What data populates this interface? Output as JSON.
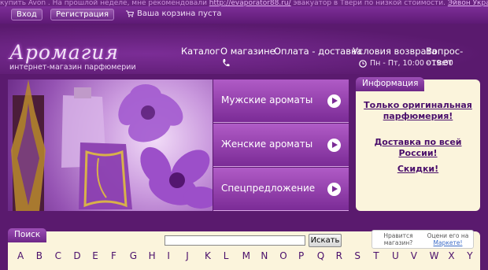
{
  "marquee": {
    "pre": "купить Avon . На прошлой неделе, мне рекомендовали",
    "link": "http://evaporator88.ru/",
    "post": "эвакуатор в Твери по низкой стоимости.",
    "tail": "Эйвон Украина"
  },
  "topbar": {
    "login_label": "Вход",
    "register_label": "Регистрация",
    "cart_text": "Ваша корзина пуста"
  },
  "header": {
    "logo": "Аромагия",
    "logo_sub": "интернет-магазин парфюмерии",
    "nav": [
      "Каталог",
      "О магазине",
      "Оплата - доставка",
      "Условия возврата",
      "Вопрос-ответ"
    ],
    "hours": "Пн - Пт, 10:00 - 19:00"
  },
  "menu": {
    "items": [
      "Мужские ароматы",
      "Женские ароматы",
      "Спецпредложение"
    ]
  },
  "info": {
    "title": "Информация",
    "links": [
      "Только оригинальная парфюмерия!",
      "Доставка по всей России!",
      "Скидки!"
    ]
  },
  "search": {
    "title": "Поиск",
    "value": "",
    "button_label": "Искать"
  },
  "market": {
    "left": "Нравится магазин?",
    "right_pre": "Оцени его на",
    "right_link": "Маркете!"
  },
  "alphabet": [
    "A",
    "B",
    "C",
    "D",
    "E",
    "F",
    "G",
    "H",
    "I",
    "J",
    "K",
    "L",
    "M",
    "N",
    "O",
    "P",
    "Q",
    "R",
    "S",
    "T",
    "U",
    "V",
    "W",
    "X",
    "Y"
  ],
  "colors": {
    "background": "#5a1a6e",
    "menu_item": "#9a45b3",
    "panel": "#fbf4dc",
    "link": "#4a0f6b"
  }
}
